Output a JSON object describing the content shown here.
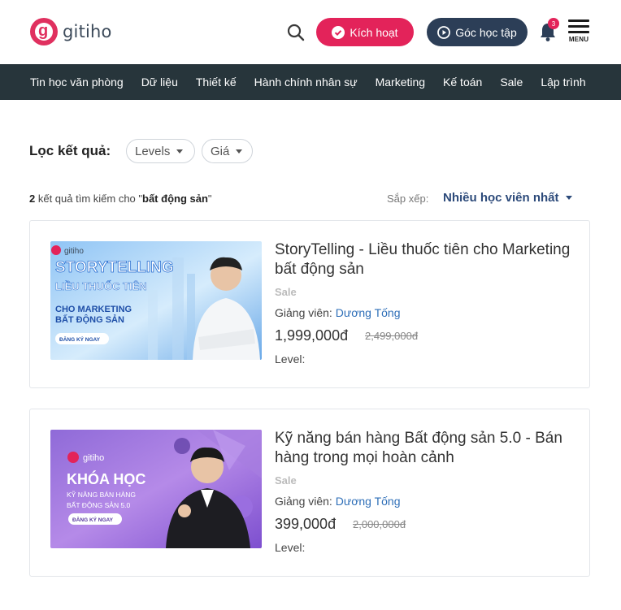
{
  "header": {
    "logo_text": "gitiho",
    "logo_mark": "g",
    "activate_label": "Kích hoạt",
    "study_label": "Góc học tập",
    "notification_count": "3",
    "menu_label": "MENU"
  },
  "nav": {
    "items": [
      "Tin học văn phòng",
      "Dữ liệu",
      "Thiết kế",
      "Hành chính nhân sự",
      "Marketing",
      "Kế toán",
      "Sale",
      "Lập trình"
    ]
  },
  "filter": {
    "label": "Lọc kết quả:",
    "levels_label": "Levels",
    "price_label": "Giá"
  },
  "results": {
    "count": "2",
    "text_before": " kết quả tìm kiếm cho \"",
    "query": "bất động sản",
    "text_after": "\"",
    "sort_label": "Sắp xếp:",
    "sort_value": "Nhiều học viên nhất"
  },
  "courses": [
    {
      "title": "StoryTelling - Liều thuốc tiên cho Marketing bất động sản",
      "badge": "Sale",
      "teacher_label": "Giảng viên:",
      "teacher_name": "Dương Tống",
      "price": "1,999,000đ",
      "old_price": "2,499,000đ",
      "level_label": "Level:",
      "thumb": {
        "brand": "gitiho",
        "line1": "STORYTELLING",
        "line2": "LIỀU THUỐC TIÊN",
        "line3": "CHO MARKETING",
        "line4": "BẤT ĐỘNG SẢN",
        "cta": "ĐĂNG KÝ NGAY"
      }
    },
    {
      "title": "Kỹ năng bán hàng Bất động sản 5.0 - Bán hàng trong mọi hoàn cảnh",
      "badge": "Sale",
      "teacher_label": "Giảng viên:",
      "teacher_name": "Dương Tống",
      "price": "399,000đ",
      "old_price": "2,000,000đ",
      "level_label": "Level:",
      "thumb": {
        "brand": "gitiho",
        "line1": "KHÓA HỌC",
        "line2": "KỸ NĂNG BÁN HÀNG",
        "line3": "BẤT ĐỘNG SẢN 5.0",
        "cta": "ĐĂNG KÝ NGAY"
      }
    }
  ],
  "colors": {
    "brand_pink": "#e3235a",
    "navy": "#2c3e57",
    "nav_bg": "#27353b",
    "link_blue": "#2f6fb8"
  }
}
